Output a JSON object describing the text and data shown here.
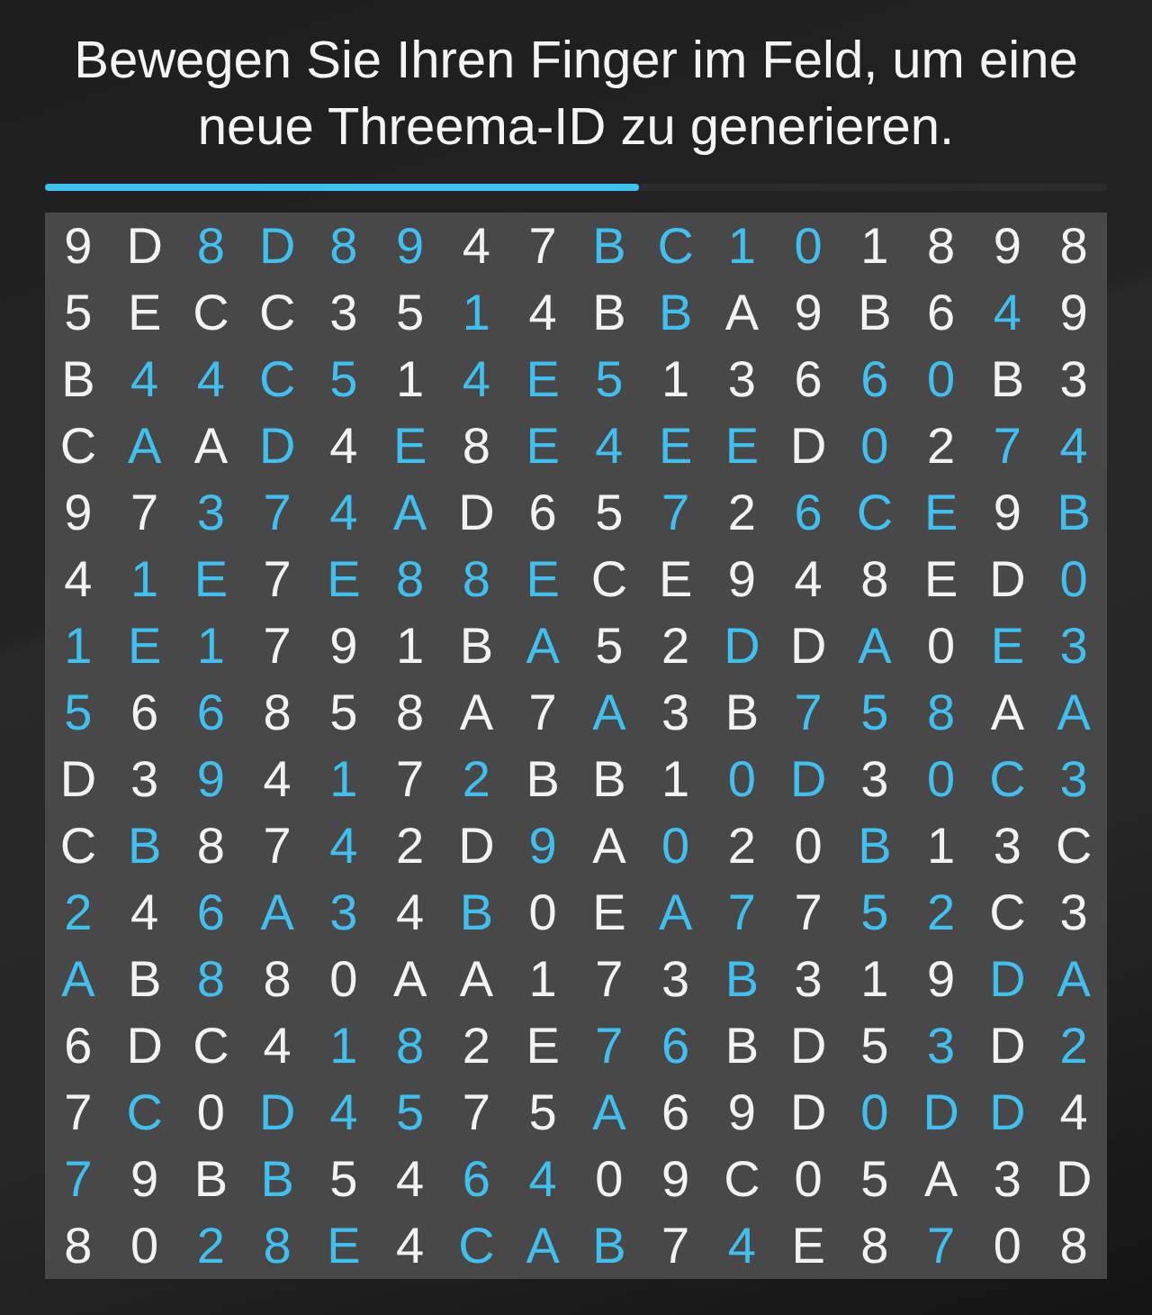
{
  "instruction": "Bewegen Sie Ihren Finger im Feld, um eine neue Threema-ID zu generieren.",
  "progress": {
    "level": 0.56
  },
  "grid": {
    "rows": [
      {
        "cells": [
          {
            "char": "9",
            "highlighted": false
          },
          {
            "char": "D",
            "highlighted": false
          },
          {
            "char": "8",
            "highlighted": true
          },
          {
            "char": "D",
            "highlighted": true
          },
          {
            "char": "8",
            "highlighted": true
          },
          {
            "char": "9",
            "highlighted": true
          },
          {
            "char": "4",
            "highlighted": false
          },
          {
            "char": "7",
            "highlighted": false
          },
          {
            "char": "B",
            "highlighted": true
          },
          {
            "char": "C",
            "highlighted": true
          },
          {
            "char": "1",
            "highlighted": true
          },
          {
            "char": "0",
            "highlighted": true
          },
          {
            "char": "1",
            "highlighted": false
          },
          {
            "char": "8",
            "highlighted": false
          },
          {
            "char": "9",
            "highlighted": false
          },
          {
            "char": "8",
            "highlighted": false
          }
        ]
      },
      {
        "cells": [
          {
            "char": "5",
            "highlighted": false
          },
          {
            "char": "E",
            "highlighted": false
          },
          {
            "char": "C",
            "highlighted": false
          },
          {
            "char": "C",
            "highlighted": false
          },
          {
            "char": "3",
            "highlighted": false
          },
          {
            "char": "5",
            "highlighted": false
          },
          {
            "char": "1",
            "highlighted": true
          },
          {
            "char": "4",
            "highlighted": false
          },
          {
            "char": "B",
            "highlighted": false
          },
          {
            "char": "B",
            "highlighted": true
          },
          {
            "char": "A",
            "highlighted": false
          },
          {
            "char": "9",
            "highlighted": false
          },
          {
            "char": "B",
            "highlighted": false
          },
          {
            "char": "6",
            "highlighted": false
          },
          {
            "char": "4",
            "highlighted": true
          },
          {
            "char": "9",
            "highlighted": false
          }
        ]
      },
      {
        "cells": [
          {
            "char": "B",
            "highlighted": false
          },
          {
            "char": "4",
            "highlighted": true
          },
          {
            "char": "4",
            "highlighted": true
          },
          {
            "char": "C",
            "highlighted": true
          },
          {
            "char": "5",
            "highlighted": true
          },
          {
            "char": "1",
            "highlighted": false
          },
          {
            "char": "4",
            "highlighted": true
          },
          {
            "char": "E",
            "highlighted": true
          },
          {
            "char": "5",
            "highlighted": true
          },
          {
            "char": "1",
            "highlighted": false
          },
          {
            "char": "3",
            "highlighted": false
          },
          {
            "char": "6",
            "highlighted": false
          },
          {
            "char": "6",
            "highlighted": true
          },
          {
            "char": "0",
            "highlighted": true
          },
          {
            "char": "B",
            "highlighted": false
          },
          {
            "char": "3",
            "highlighted": false
          }
        ]
      },
      {
        "cells": [
          {
            "char": "C",
            "highlighted": false
          },
          {
            "char": "A",
            "highlighted": true
          },
          {
            "char": "A",
            "highlighted": false
          },
          {
            "char": "D",
            "highlighted": true
          },
          {
            "char": "4",
            "highlighted": false
          },
          {
            "char": "E",
            "highlighted": true
          },
          {
            "char": "8",
            "highlighted": false
          },
          {
            "char": "E",
            "highlighted": true
          },
          {
            "char": "4",
            "highlighted": true
          },
          {
            "char": "E",
            "highlighted": true
          },
          {
            "char": "E",
            "highlighted": true
          },
          {
            "char": "D",
            "highlighted": false
          },
          {
            "char": "0",
            "highlighted": true
          },
          {
            "char": "2",
            "highlighted": false
          },
          {
            "char": "7",
            "highlighted": true
          },
          {
            "char": "4",
            "highlighted": true
          }
        ]
      },
      {
        "cells": [
          {
            "char": "9",
            "highlighted": false
          },
          {
            "char": "7",
            "highlighted": false
          },
          {
            "char": "3",
            "highlighted": true
          },
          {
            "char": "7",
            "highlighted": true
          },
          {
            "char": "4",
            "highlighted": true
          },
          {
            "char": "A",
            "highlighted": true
          },
          {
            "char": "D",
            "highlighted": false
          },
          {
            "char": "6",
            "highlighted": false
          },
          {
            "char": "5",
            "highlighted": false
          },
          {
            "char": "7",
            "highlighted": true
          },
          {
            "char": "2",
            "highlighted": false
          },
          {
            "char": "6",
            "highlighted": true
          },
          {
            "char": "C",
            "highlighted": true
          },
          {
            "char": "E",
            "highlighted": true
          },
          {
            "char": "9",
            "highlighted": false
          },
          {
            "char": "B",
            "highlighted": true
          }
        ]
      },
      {
        "cells": [
          {
            "char": "4",
            "highlighted": false
          },
          {
            "char": "1",
            "highlighted": true
          },
          {
            "char": "E",
            "highlighted": true
          },
          {
            "char": "7",
            "highlighted": false
          },
          {
            "char": "E",
            "highlighted": true
          },
          {
            "char": "8",
            "highlighted": true
          },
          {
            "char": "8",
            "highlighted": true
          },
          {
            "char": "E",
            "highlighted": true
          },
          {
            "char": "C",
            "highlighted": false
          },
          {
            "char": "E",
            "highlighted": false
          },
          {
            "char": "9",
            "highlighted": false
          },
          {
            "char": "4",
            "highlighted": false
          },
          {
            "char": "8",
            "highlighted": false
          },
          {
            "char": "E",
            "highlighted": false
          },
          {
            "char": "D",
            "highlighted": false
          },
          {
            "char": "0",
            "highlighted": true
          }
        ]
      },
      {
        "cells": [
          {
            "char": "1",
            "highlighted": true
          },
          {
            "char": "E",
            "highlighted": true
          },
          {
            "char": "1",
            "highlighted": true
          },
          {
            "char": "7",
            "highlighted": false
          },
          {
            "char": "9",
            "highlighted": false
          },
          {
            "char": "1",
            "highlighted": false
          },
          {
            "char": "B",
            "highlighted": false
          },
          {
            "char": "A",
            "highlighted": true
          },
          {
            "char": "5",
            "highlighted": false
          },
          {
            "char": "2",
            "highlighted": false
          },
          {
            "char": "D",
            "highlighted": true
          },
          {
            "char": "D",
            "highlighted": false
          },
          {
            "char": "A",
            "highlighted": true
          },
          {
            "char": "0",
            "highlighted": false
          },
          {
            "char": "E",
            "highlighted": true
          },
          {
            "char": "3",
            "highlighted": true
          }
        ]
      },
      {
        "cells": [
          {
            "char": "5",
            "highlighted": true
          },
          {
            "char": "6",
            "highlighted": false
          },
          {
            "char": "6",
            "highlighted": true
          },
          {
            "char": "8",
            "highlighted": false
          },
          {
            "char": "5",
            "highlighted": false
          },
          {
            "char": "8",
            "highlighted": false
          },
          {
            "char": "A",
            "highlighted": false
          },
          {
            "char": "7",
            "highlighted": false
          },
          {
            "char": "A",
            "highlighted": true
          },
          {
            "char": "3",
            "highlighted": false
          },
          {
            "char": "B",
            "highlighted": false
          },
          {
            "char": "7",
            "highlighted": true
          },
          {
            "char": "5",
            "highlighted": true
          },
          {
            "char": "8",
            "highlighted": true
          },
          {
            "char": "A",
            "highlighted": false
          },
          {
            "char": "A",
            "highlighted": true
          }
        ]
      },
      {
        "cells": [
          {
            "char": "D",
            "highlighted": false
          },
          {
            "char": "3",
            "highlighted": false
          },
          {
            "char": "9",
            "highlighted": true
          },
          {
            "char": "4",
            "highlighted": false
          },
          {
            "char": "1",
            "highlighted": true
          },
          {
            "char": "7",
            "highlighted": false
          },
          {
            "char": "2",
            "highlighted": true
          },
          {
            "char": "B",
            "highlighted": false
          },
          {
            "char": "B",
            "highlighted": false
          },
          {
            "char": "1",
            "highlighted": false
          },
          {
            "char": "0",
            "highlighted": true
          },
          {
            "char": "D",
            "highlighted": true
          },
          {
            "char": "3",
            "highlighted": false
          },
          {
            "char": "0",
            "highlighted": true
          },
          {
            "char": "C",
            "highlighted": true
          },
          {
            "char": "3",
            "highlighted": true
          }
        ]
      },
      {
        "cells": [
          {
            "char": "C",
            "highlighted": false
          },
          {
            "char": "B",
            "highlighted": true
          },
          {
            "char": "8",
            "highlighted": false
          },
          {
            "char": "7",
            "highlighted": false
          },
          {
            "char": "4",
            "highlighted": true
          },
          {
            "char": "2",
            "highlighted": false
          },
          {
            "char": "D",
            "highlighted": false
          },
          {
            "char": "9",
            "highlighted": true
          },
          {
            "char": "A",
            "highlighted": false
          },
          {
            "char": "0",
            "highlighted": true
          },
          {
            "char": "2",
            "highlighted": false
          },
          {
            "char": "0",
            "highlighted": false
          },
          {
            "char": "B",
            "highlighted": true
          },
          {
            "char": "1",
            "highlighted": false
          },
          {
            "char": "3",
            "highlighted": false
          },
          {
            "char": "C",
            "highlighted": false
          }
        ]
      },
      {
        "cells": [
          {
            "char": "2",
            "highlighted": true
          },
          {
            "char": "4",
            "highlighted": false
          },
          {
            "char": "6",
            "highlighted": true
          },
          {
            "char": "A",
            "highlighted": true
          },
          {
            "char": "3",
            "highlighted": true
          },
          {
            "char": "4",
            "highlighted": false
          },
          {
            "char": "B",
            "highlighted": true
          },
          {
            "char": "0",
            "highlighted": false
          },
          {
            "char": "E",
            "highlighted": false
          },
          {
            "char": "A",
            "highlighted": true
          },
          {
            "char": "7",
            "highlighted": true
          },
          {
            "char": "7",
            "highlighted": false
          },
          {
            "char": "5",
            "highlighted": true
          },
          {
            "char": "2",
            "highlighted": true
          },
          {
            "char": "C",
            "highlighted": false
          },
          {
            "char": "3",
            "highlighted": false
          }
        ]
      },
      {
        "cells": [
          {
            "char": "A",
            "highlighted": true
          },
          {
            "char": "B",
            "highlighted": false
          },
          {
            "char": "8",
            "highlighted": true
          },
          {
            "char": "8",
            "highlighted": false
          },
          {
            "char": "0",
            "highlighted": false
          },
          {
            "char": "A",
            "highlighted": false
          },
          {
            "char": "A",
            "highlighted": false
          },
          {
            "char": "1",
            "highlighted": false
          },
          {
            "char": "7",
            "highlighted": false
          },
          {
            "char": "3",
            "highlighted": false
          },
          {
            "char": "B",
            "highlighted": true
          },
          {
            "char": "3",
            "highlighted": false
          },
          {
            "char": "1",
            "highlighted": false
          },
          {
            "char": "9",
            "highlighted": false
          },
          {
            "char": "D",
            "highlighted": true
          },
          {
            "char": "A",
            "highlighted": true
          }
        ]
      },
      {
        "cells": [
          {
            "char": "6",
            "highlighted": false
          },
          {
            "char": "D",
            "highlighted": false
          },
          {
            "char": "C",
            "highlighted": false
          },
          {
            "char": "4",
            "highlighted": false
          },
          {
            "char": "1",
            "highlighted": true
          },
          {
            "char": "8",
            "highlighted": true
          },
          {
            "char": "2",
            "highlighted": false
          },
          {
            "char": "E",
            "highlighted": false
          },
          {
            "char": "7",
            "highlighted": true
          },
          {
            "char": "6",
            "highlighted": true
          },
          {
            "char": "B",
            "highlighted": false
          },
          {
            "char": "D",
            "highlighted": false
          },
          {
            "char": "5",
            "highlighted": false
          },
          {
            "char": "3",
            "highlighted": true
          },
          {
            "char": "D",
            "highlighted": false
          },
          {
            "char": "2",
            "highlighted": true
          }
        ]
      },
      {
        "cells": [
          {
            "char": "7",
            "highlighted": false
          },
          {
            "char": "C",
            "highlighted": true
          },
          {
            "char": "0",
            "highlighted": false
          },
          {
            "char": "D",
            "highlighted": true
          },
          {
            "char": "4",
            "highlighted": true
          },
          {
            "char": "5",
            "highlighted": true
          },
          {
            "char": "7",
            "highlighted": false
          },
          {
            "char": "5",
            "highlighted": false
          },
          {
            "char": "A",
            "highlighted": true
          },
          {
            "char": "6",
            "highlighted": false
          },
          {
            "char": "9",
            "highlighted": false
          },
          {
            "char": "D",
            "highlighted": false
          },
          {
            "char": "0",
            "highlighted": true
          },
          {
            "char": "D",
            "highlighted": true
          },
          {
            "char": "D",
            "highlighted": true
          },
          {
            "char": "4",
            "highlighted": false
          }
        ]
      },
      {
        "cells": [
          {
            "char": "7",
            "highlighted": true
          },
          {
            "char": "9",
            "highlighted": false
          },
          {
            "char": "B",
            "highlighted": false
          },
          {
            "char": "B",
            "highlighted": true
          },
          {
            "char": "5",
            "highlighted": false
          },
          {
            "char": "4",
            "highlighted": false
          },
          {
            "char": "6",
            "highlighted": true
          },
          {
            "char": "4",
            "highlighted": true
          },
          {
            "char": "0",
            "highlighted": false
          },
          {
            "char": "9",
            "highlighted": false
          },
          {
            "char": "C",
            "highlighted": false
          },
          {
            "char": "0",
            "highlighted": false
          },
          {
            "char": "5",
            "highlighted": false
          },
          {
            "char": "A",
            "highlighted": false
          },
          {
            "char": "3",
            "highlighted": false
          },
          {
            "char": "D",
            "highlighted": false
          }
        ]
      },
      {
        "cells": [
          {
            "char": "8",
            "highlighted": false
          },
          {
            "char": "0",
            "highlighted": false
          },
          {
            "char": "2",
            "highlighted": true
          },
          {
            "char": "8",
            "highlighted": true
          },
          {
            "char": "E",
            "highlighted": true
          },
          {
            "char": "4",
            "highlighted": false
          },
          {
            "char": "C",
            "highlighted": true
          },
          {
            "char": "A",
            "highlighted": true
          },
          {
            "char": "B",
            "highlighted": true
          },
          {
            "char": "7",
            "highlighted": false
          },
          {
            "char": "4",
            "highlighted": true
          },
          {
            "char": "E",
            "highlighted": false
          },
          {
            "char": "8",
            "highlighted": false
          },
          {
            "char": "7",
            "highlighted": true
          },
          {
            "char": "0",
            "highlighted": false
          },
          {
            "char": "8",
            "highlighted": false
          }
        ]
      }
    ]
  }
}
